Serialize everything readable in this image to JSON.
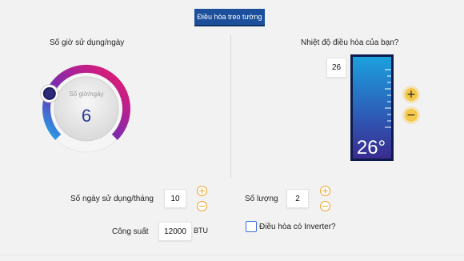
{
  "header": {
    "tab_label": "Điều hòa treo tường"
  },
  "hours": {
    "title": "Số giờ sử dụng/ngày",
    "inner_label": "Số giờ/ngày",
    "value": "6",
    "level": 0.25
  },
  "temperature": {
    "title": "Nhiệt độ điều hòa của bạn?",
    "value": "26",
    "display": "26°",
    "increase_symbol": "+",
    "decrease_symbol": "−"
  },
  "days": {
    "label": "Số ngày sử dụng/tháng",
    "value": "10",
    "plus": "+",
    "minus": "−"
  },
  "quantity": {
    "label": "Số lượng",
    "value": "2",
    "plus": "+",
    "minus": "−"
  },
  "power": {
    "label": "Công suất",
    "value": "12000",
    "unit": "BTU"
  },
  "inverter": {
    "label": "Điều hòa có Inverter?",
    "checked": false
  },
  "colors": {
    "accent_blue": "#1b4f9c",
    "gauge_start": "#1fa8e8",
    "gauge_end": "#e91e63",
    "button_orange": "#f0a020"
  }
}
